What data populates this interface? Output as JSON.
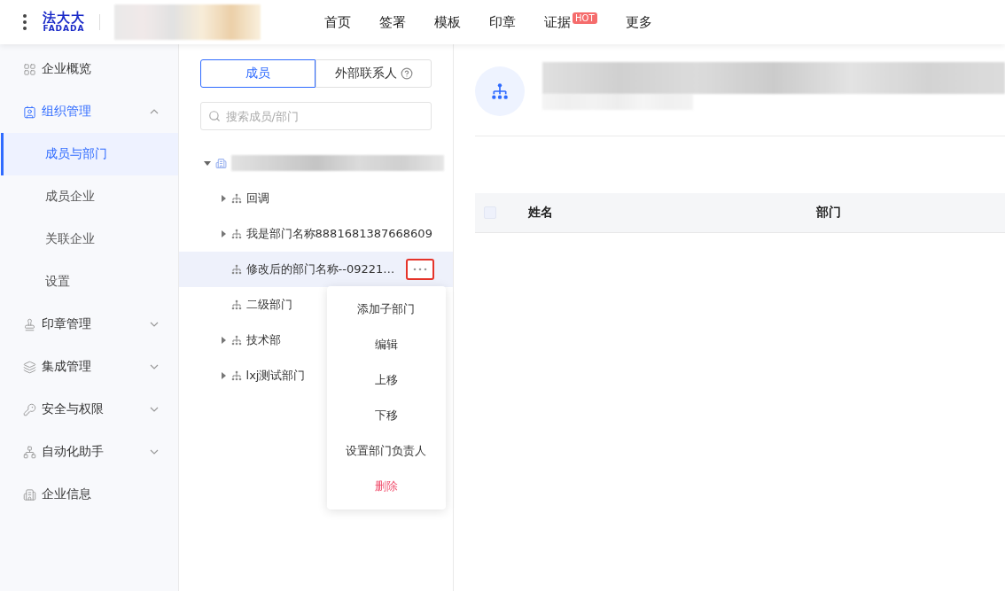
{
  "header": {
    "logo": {
      "cn": "法大大",
      "en": "FADADA"
    },
    "nav": [
      {
        "label": "首页"
      },
      {
        "label": "签署"
      },
      {
        "label": "模板"
      },
      {
        "label": "印章"
      },
      {
        "label": "证据",
        "badge": "HOT"
      },
      {
        "label": "更多"
      }
    ]
  },
  "sidebar": {
    "items": [
      {
        "label": "企业概览",
        "selected": false,
        "kind": "link"
      },
      {
        "label": "组织管理",
        "selected": true,
        "kind": "group",
        "expanded": true,
        "children": [
          {
            "label": "成员与部门",
            "selected": true
          },
          {
            "label": "成员企业",
            "selected": false
          },
          {
            "label": "关联企业",
            "selected": false
          },
          {
            "label": "设置",
            "selected": false
          }
        ]
      },
      {
        "label": "印章管理",
        "selected": false,
        "kind": "group",
        "expanded": false
      },
      {
        "label": "集成管理",
        "selected": false,
        "kind": "group",
        "expanded": false
      },
      {
        "label": "安全与权限",
        "selected": false,
        "kind": "group",
        "expanded": false
      },
      {
        "label": "自动化助手",
        "selected": false,
        "kind": "group",
        "expanded": false
      },
      {
        "label": "企业信息",
        "selected": false,
        "kind": "link"
      }
    ]
  },
  "org_panel": {
    "tabs": [
      {
        "label": "成员",
        "selected": true,
        "help": false
      },
      {
        "label": "外部联系人",
        "selected": false,
        "help": true
      }
    ],
    "search": {
      "placeholder": "搜索成员/部门"
    },
    "tree": {
      "expanded": true,
      "children": [
        {
          "label": "回调",
          "has_children": true,
          "selected": false
        },
        {
          "label": "我是部门名称8881681387668609",
          "has_children": true,
          "selected": false
        },
        {
          "label": "修改后的部门名称--09221…",
          "has_children": false,
          "selected": true
        },
        {
          "label": "二级部门",
          "has_children": false,
          "selected": false
        },
        {
          "label": "技术部",
          "has_children": true,
          "selected": false
        },
        {
          "label": "lxj测试部门",
          "has_children": true,
          "selected": false
        }
      ]
    },
    "context_menu": [
      {
        "label": "添加子部门",
        "danger": false
      },
      {
        "label": "编辑",
        "danger": false
      },
      {
        "label": "上移",
        "danger": false
      },
      {
        "label": "下移",
        "danger": false
      },
      {
        "label": "设置部门负责人",
        "danger": false
      },
      {
        "label": "删除",
        "danger": true
      }
    ]
  },
  "detail": {
    "table": {
      "select_all": {
        "checked": false
      },
      "columns": [
        "姓名",
        "部门"
      ]
    }
  }
}
